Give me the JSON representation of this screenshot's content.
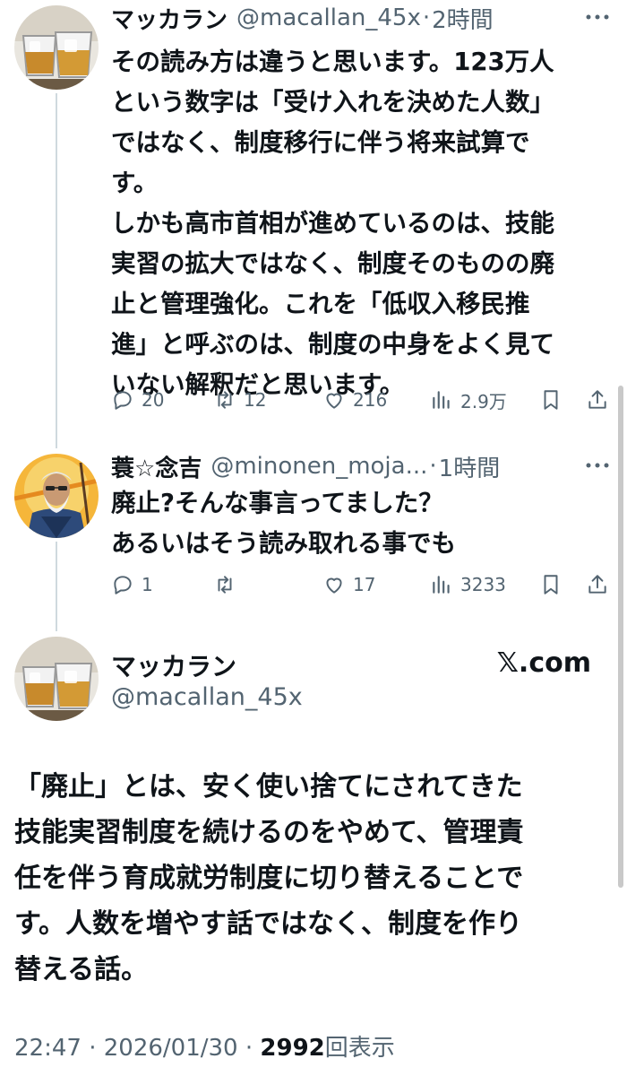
{
  "tweets": [
    {
      "name": "マッカラン",
      "handle": "@macallan_45x",
      "separator": "·",
      "time": "2時間",
      "text": "その読み方は違うと思います。123万人\nという数字は「受け入れを決めた人数」\nではなく、制度移行に伴う将来試算で\nす。\nしかも高市首相が進めているのは、技能\n実習の拡大ではなく、制度そのものの廃\n止と管理強化。これを「低収入移民推\n進」と呼ぶのは、制度の中身をよく見て\nいない解釈だと思います。",
      "replies": "20",
      "retweets": "12",
      "likes": "216",
      "views": "2.9万",
      "avatar_icon": "whisky-glass-icon"
    },
    {
      "name": "蓑☆念吉",
      "handle": "@minonen_moja...",
      "separator": "·",
      "time": "1時間",
      "text": "廃止?そんな事言ってました？\nあるいはそう読み取れる事でも",
      "replies": "1",
      "retweets": "",
      "likes": "17",
      "views": "3233",
      "avatar_icon": "samurai-illustration-icon"
    }
  ],
  "main_post": {
    "name": "マッカラン",
    "handle": "@macallan_45x",
    "brand": "𝕏.com",
    "text": "「廃止」とは、安く使い捨てにされてきた\n技能実習制度を続けるのをやめて、管理責\n任を伴う育成就労制度に切り替えることで\nす。人数を増やす話ではなく、制度を作り\n替える話。",
    "time": "22:47",
    "date": "2026/01/30",
    "views_count": "2992",
    "views_label": "回表示",
    "separator": "·",
    "avatar_icon": "whisky-glass-icon"
  },
  "icons": [
    "more-icon",
    "reply-icon",
    "retweet-icon",
    "like-icon",
    "views-icon",
    "bookmark-icon",
    "share-icon"
  ],
  "colors": {
    "text": "#0f1419",
    "secondary": "#536471",
    "thread_line": "#cfd9de"
  }
}
